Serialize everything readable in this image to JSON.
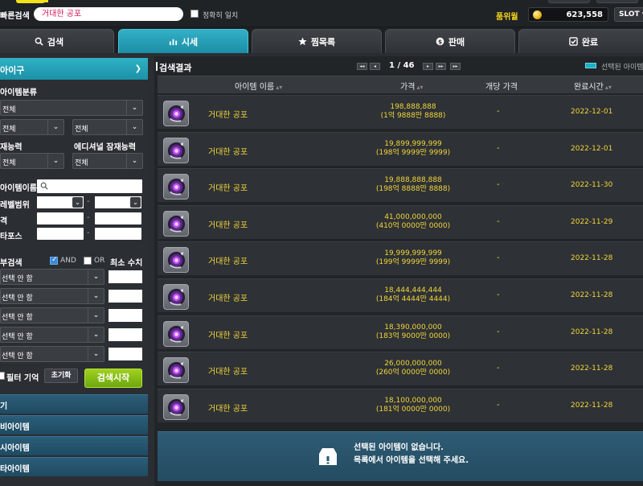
{
  "topbar": {
    "quick_search_label": "빠른검색",
    "quick_search_value": "거대한 공포",
    "exact_match_label": "정확히 일치",
    "price_label": "품위월",
    "price_value": "623,558",
    "slot_label": "SLOT"
  },
  "tabs": [
    {
      "label": "검색",
      "icon": "search-icon"
    },
    {
      "label": "시세",
      "icon": "bar-chart-icon",
      "active": true
    },
    {
      "label": "찜목록",
      "icon": "star-icon"
    },
    {
      "label": "판매",
      "icon": "coin-icon"
    },
    {
      "label": "완료",
      "icon": "check-icon"
    }
  ],
  "filters": {
    "category_header": "아이구",
    "item_class_label": "아이템분류",
    "item_class_value": "전체",
    "sub_class_1": "전체",
    "sub_class_2": "전체",
    "potential_label": "재능력",
    "additional_label": "에디셔널 잠재능력",
    "potential_value": "전체",
    "additional_value": "전체",
    "item_name_label": "아이템이름",
    "level_range_label": "레벨범위",
    "price_label": "격",
    "starforce_label": "타포스",
    "detail_label": "부검색",
    "and_label": "AND",
    "or_label": "OR",
    "min_value_label": "최소 수치",
    "option_placeholder": "선택 안 함",
    "remember_label": "필터 기억",
    "reset_label": "초기화",
    "search_label": "검색시작"
  },
  "categories": [
    "기",
    "비아이템",
    "시아이템",
    "타아이템"
  ],
  "results": {
    "title": "검색결과",
    "page_current": "1",
    "page_total": "46",
    "selected_legend": "선택된 아이템",
    "columns": [
      "아이템 이름",
      "가격",
      "개당 가격",
      "완료시간"
    ],
    "rows": [
      {
        "name": "거대한 공포",
        "price": "198,888,888",
        "price_kr": "(1억 9888만 8888)",
        "unit": "-",
        "date": "2022-12-01"
      },
      {
        "name": "거대한 공포",
        "price": "19,899,999,999",
        "price_kr": "(198억 9999만 9999)",
        "unit": "-",
        "date": "2022-12-01"
      },
      {
        "name": "거대한 공포",
        "price": "19,888,888,888",
        "price_kr": "(198억 8888만 8888)",
        "unit": "-",
        "date": "2022-11-30"
      },
      {
        "name": "거대한 공포",
        "price": "41,000,000,000",
        "price_kr": "(410억 0000만 0000)",
        "unit": "-",
        "date": "2022-11-29"
      },
      {
        "name": "거대한 공포",
        "price": "19,999,999,999",
        "price_kr": "(199억 9999만 9999)",
        "unit": "-",
        "date": "2022-11-28"
      },
      {
        "name": "거대한 공포",
        "price": "18,444,444,444",
        "price_kr": "(184억 4444만 4444)",
        "unit": "-",
        "date": "2022-11-28"
      },
      {
        "name": "거대한 공포",
        "price": "18,390,000,000",
        "price_kr": "(183억 9000만 0000)",
        "unit": "-",
        "date": "2022-11-28"
      },
      {
        "name": "거대한 공포",
        "price": "26,000,000,000",
        "price_kr": "(260억 0000만 0000)",
        "unit": "-",
        "date": "2022-11-28"
      },
      {
        "name": "거대한 공포",
        "price": "18,100,000,000",
        "price_kr": "(181억 0000만 0000)",
        "unit": "-",
        "date": "2022-11-28"
      }
    ],
    "notice_line1": "선택된 아이템이 없습니다.",
    "notice_line2": "목록에서 아이템을 선택해 주세요."
  },
  "colors": {
    "accent": "#1fa3b9",
    "gold": "#f1d63b",
    "search_green": "#8cc41a"
  }
}
